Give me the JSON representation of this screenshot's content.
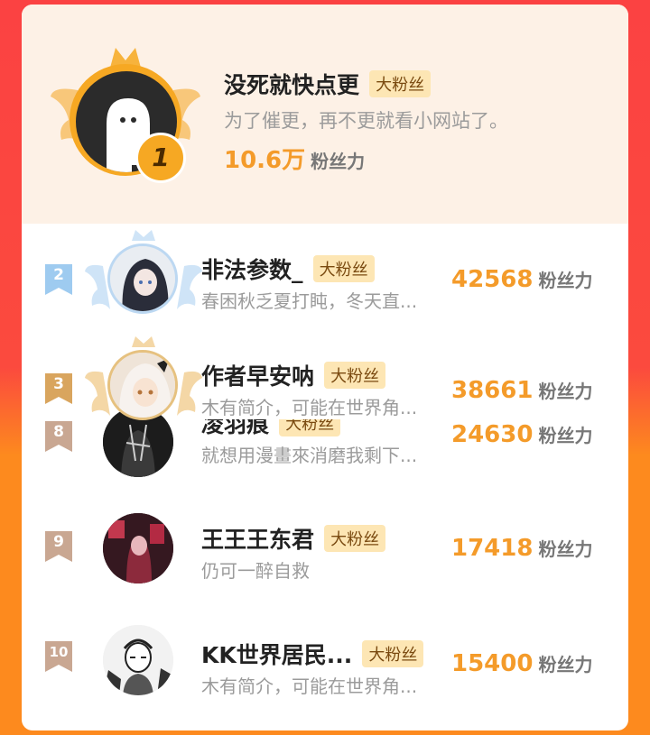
{
  "badge_label": "大粉丝",
  "fans_unit": "粉丝力",
  "colors": {
    "accent_orange": "#f49b2a",
    "badge_bg": "#fde6b4",
    "rank2": "#9ecbf0",
    "rank3": "#d9a55e",
    "rank_other": "#c9a792"
  },
  "top_fan": {
    "rank": "1",
    "name": "没死就快点更",
    "desc": "为了催更，再不更就看小网站了。",
    "fans_value": "10.6万",
    "avatar_icon": "ghost-avatar-icon"
  },
  "list": [
    {
      "rank": "2",
      "name": "非法参数_",
      "desc": "春困秋乏夏打盹，冬天直...",
      "fans_value": "42568"
    },
    {
      "rank": "3",
      "name": "作者早安呐",
      "desc": "木有简介，可能在世界角...",
      "fans_value": "38661"
    },
    {
      "rank": "8",
      "name": "凌羽痕",
      "desc": "就想用漫畫來消磨我剩下...",
      "fans_value": "24630"
    },
    {
      "rank": "9",
      "name": "王王王东君",
      "desc": "仍可一醉自救",
      "fans_value": "17418"
    },
    {
      "rank": "10",
      "name": "KK世界居民...",
      "desc": "木有简介，可能在世界角...",
      "fans_value": "15400"
    }
  ]
}
